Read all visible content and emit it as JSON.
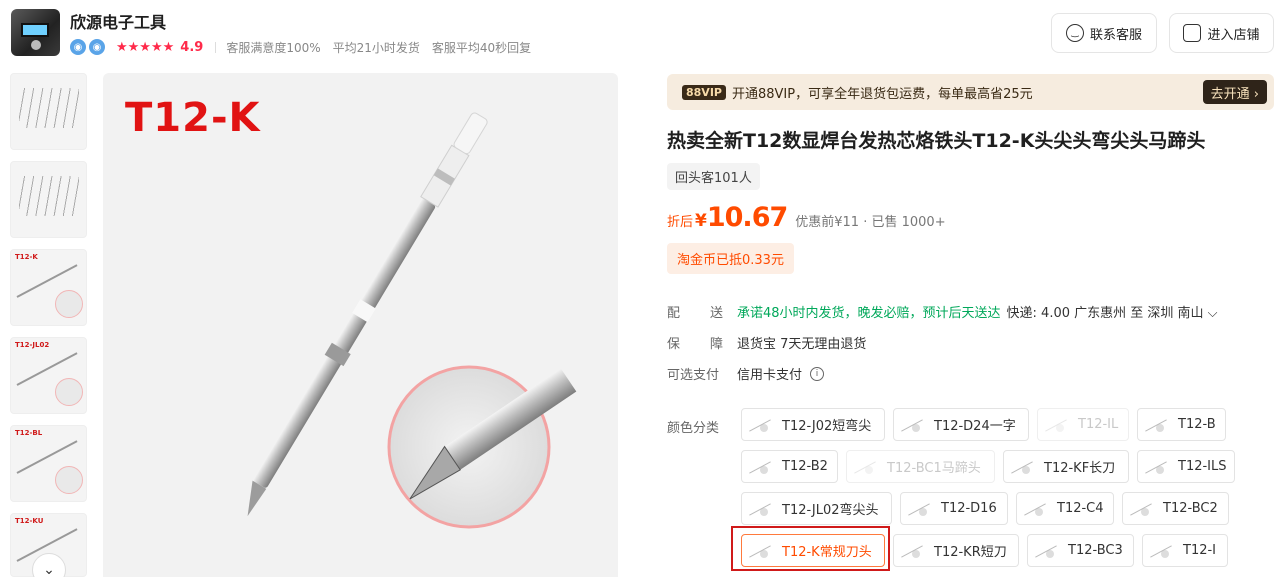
{
  "shop": {
    "name": "欣源电子工具",
    "rating": "4.9",
    "stats": [
      "客服满意度100%",
      "平均21小时发货",
      "客服平均40秒回复"
    ],
    "buttons": {
      "contact": "联系客服",
      "enter_store": "进入店铺"
    }
  },
  "gallery": {
    "main_label": "T12-K",
    "thumbs": [
      "T12-K",
      "T12-JL02",
      "T12-BL",
      "T12-KU"
    ]
  },
  "vip": {
    "tag": "88VIP",
    "text": "开通88VIP，可享全年退货包运费，每单最高省25元",
    "button": "去开通 ›"
  },
  "product": {
    "title": "热卖全新T12数显焊台发热芯烙铁头T12-K头尖头弯尖头马蹄头",
    "repeat_buyers": "回头客101人",
    "price_label": "折后",
    "currency": "¥",
    "price": "10.67",
    "original": "优惠前¥11 · 已售 1000+",
    "coin": "淘金币已抵0.33元"
  },
  "shipping": {
    "label": "配送",
    "promise": "承诺48小时内发货，晚发必赔，预计后天送达",
    "detail": "快递: 4.00  广东惠州  至  深圳 南山 ⌵"
  },
  "guarantee": {
    "label": "保障",
    "text": "退货宝 7天无理由退货"
  },
  "payment": {
    "label": "可选支付",
    "text": "信用卡支付"
  },
  "options": {
    "label": "颜色分类",
    "items": [
      "T12-J02短弯尖",
      "T12-D24一字",
      "T12-IL",
      "T12-B",
      "T12-B2",
      "T12-BC1马蹄头",
      "T12-KF长刀",
      "T12-ILS",
      "T12-JL02弯尖头",
      "T12-D16",
      "T12-C4",
      "T12-BC2",
      "T12-K常规刀头",
      "T12-KR短刀",
      "T12-BC3",
      "T12-I"
    ]
  },
  "colors": {
    "price": "#ff4b00",
    "green": "#00a85a",
    "star": "#ff2a4a"
  }
}
